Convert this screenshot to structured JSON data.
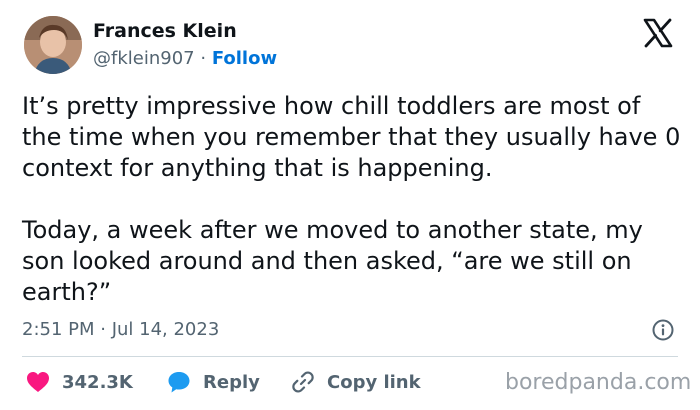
{
  "author": {
    "name": "Frances Klein",
    "handle": "@fklein907",
    "separator": "·",
    "follow_label": "Follow"
  },
  "tweet": {
    "paragraph_1": "It’s pretty impressive how chill toddlers are most of the time when you remember that they usually have 0 context for anything that is happening.",
    "paragraph_2": "Today, a week after we moved to another state, my son looked around and then asked, “are we still on earth?”"
  },
  "meta": {
    "timestamp": "2:51 PM · Jul 14, 2023"
  },
  "actions": {
    "like_count": "342.3K",
    "reply_label": "Reply",
    "copy_link_label": "Copy link"
  },
  "watermark": {
    "text": "boredpanda.com"
  },
  "icons": {
    "avatar": "avatar",
    "logo": "x-logo-icon",
    "info": "info-icon",
    "like": "heart-icon",
    "reply": "speech-bubble-icon",
    "copy": "link-icon"
  },
  "colors": {
    "accent": "#0074d9",
    "like": "#f91880",
    "reply": "#1d9bf0",
    "muted": "#536471",
    "text": "#0f1419"
  }
}
